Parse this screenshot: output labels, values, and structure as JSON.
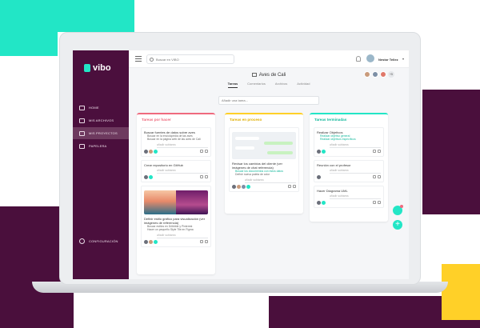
{
  "app": {
    "logo_text": "vibo"
  },
  "colors": {
    "primary": "#4b0f3d",
    "accent": "#22e6c6",
    "todo": "#ef6a7e",
    "progress": "#ffd028",
    "done": "#22e6c6"
  },
  "sidebar": {
    "items": [
      {
        "label": "HOME",
        "icon": "home-icon",
        "active": false
      },
      {
        "label": "MIS ARCHIVOS",
        "icon": "file-icon",
        "active": false
      },
      {
        "label": "MIS PROYECTOS",
        "icon": "folder-icon",
        "active": true
      },
      {
        "label": "PAPELERA",
        "icon": "trash-icon",
        "active": false
      }
    ],
    "config_label": "CONFIGURACIÓN"
  },
  "topbar": {
    "search_placeholder": "Buscar en VIBO",
    "user_name": "Nestor Tellez",
    "user_chevron": "▾"
  },
  "project": {
    "title": "Aves de Cali",
    "tabs": [
      "Tareas",
      "Comentarios",
      "Archivos",
      "Actividad"
    ],
    "member_count": "+5"
  },
  "add_task_placeholder": "Añadir una tarea...",
  "columns": {
    "por_hacer": {
      "title": "Tareas por hacer",
      "cards": [
        {
          "title": "Buscar fuentes de datos sobre aves",
          "subitems": [
            "Buscar en la enciclopedia de las aves",
            "Buscar en la página web de las aves de Cali"
          ],
          "comment": "añadir subtarea"
        },
        {
          "title": "Crear repositorio en GitHub",
          "comment": "añadir subtarea"
        },
        {
          "title": "Definir estilo gráfico para visualización (ver imágenes de referencia)",
          "subitems": [
            "Buscar estilos en Dribbble y Pinterest",
            "Hacer un pequeño Style Tile en Figma"
          ],
          "comment": "añadir subtarea"
        }
      ]
    },
    "en_proceso": {
      "title": "Tareas en proceso",
      "cards": [
        {
          "title": "Revisar los cambios del cliente (ver imágenes de chat referencia)",
          "subitems": [
            "Buscar los documentos con estos datos",
            "Definir nueva paleta de color"
          ],
          "comment": "añadir subtarea"
        }
      ]
    },
    "terminadas": {
      "title": "Tareas terminadas",
      "cards": [
        {
          "title": "Realizar Objetivos",
          "subitems": [
            "Realizar objetivo general",
            "Realizar objetivos específicos"
          ],
          "comment": "añadir subtarea"
        },
        {
          "title": "Reunión con el profesor",
          "comment": "añadir subtarea"
        },
        {
          "title": "Hacer Diagrama UML",
          "comment": "añadir subtarea"
        }
      ]
    }
  }
}
